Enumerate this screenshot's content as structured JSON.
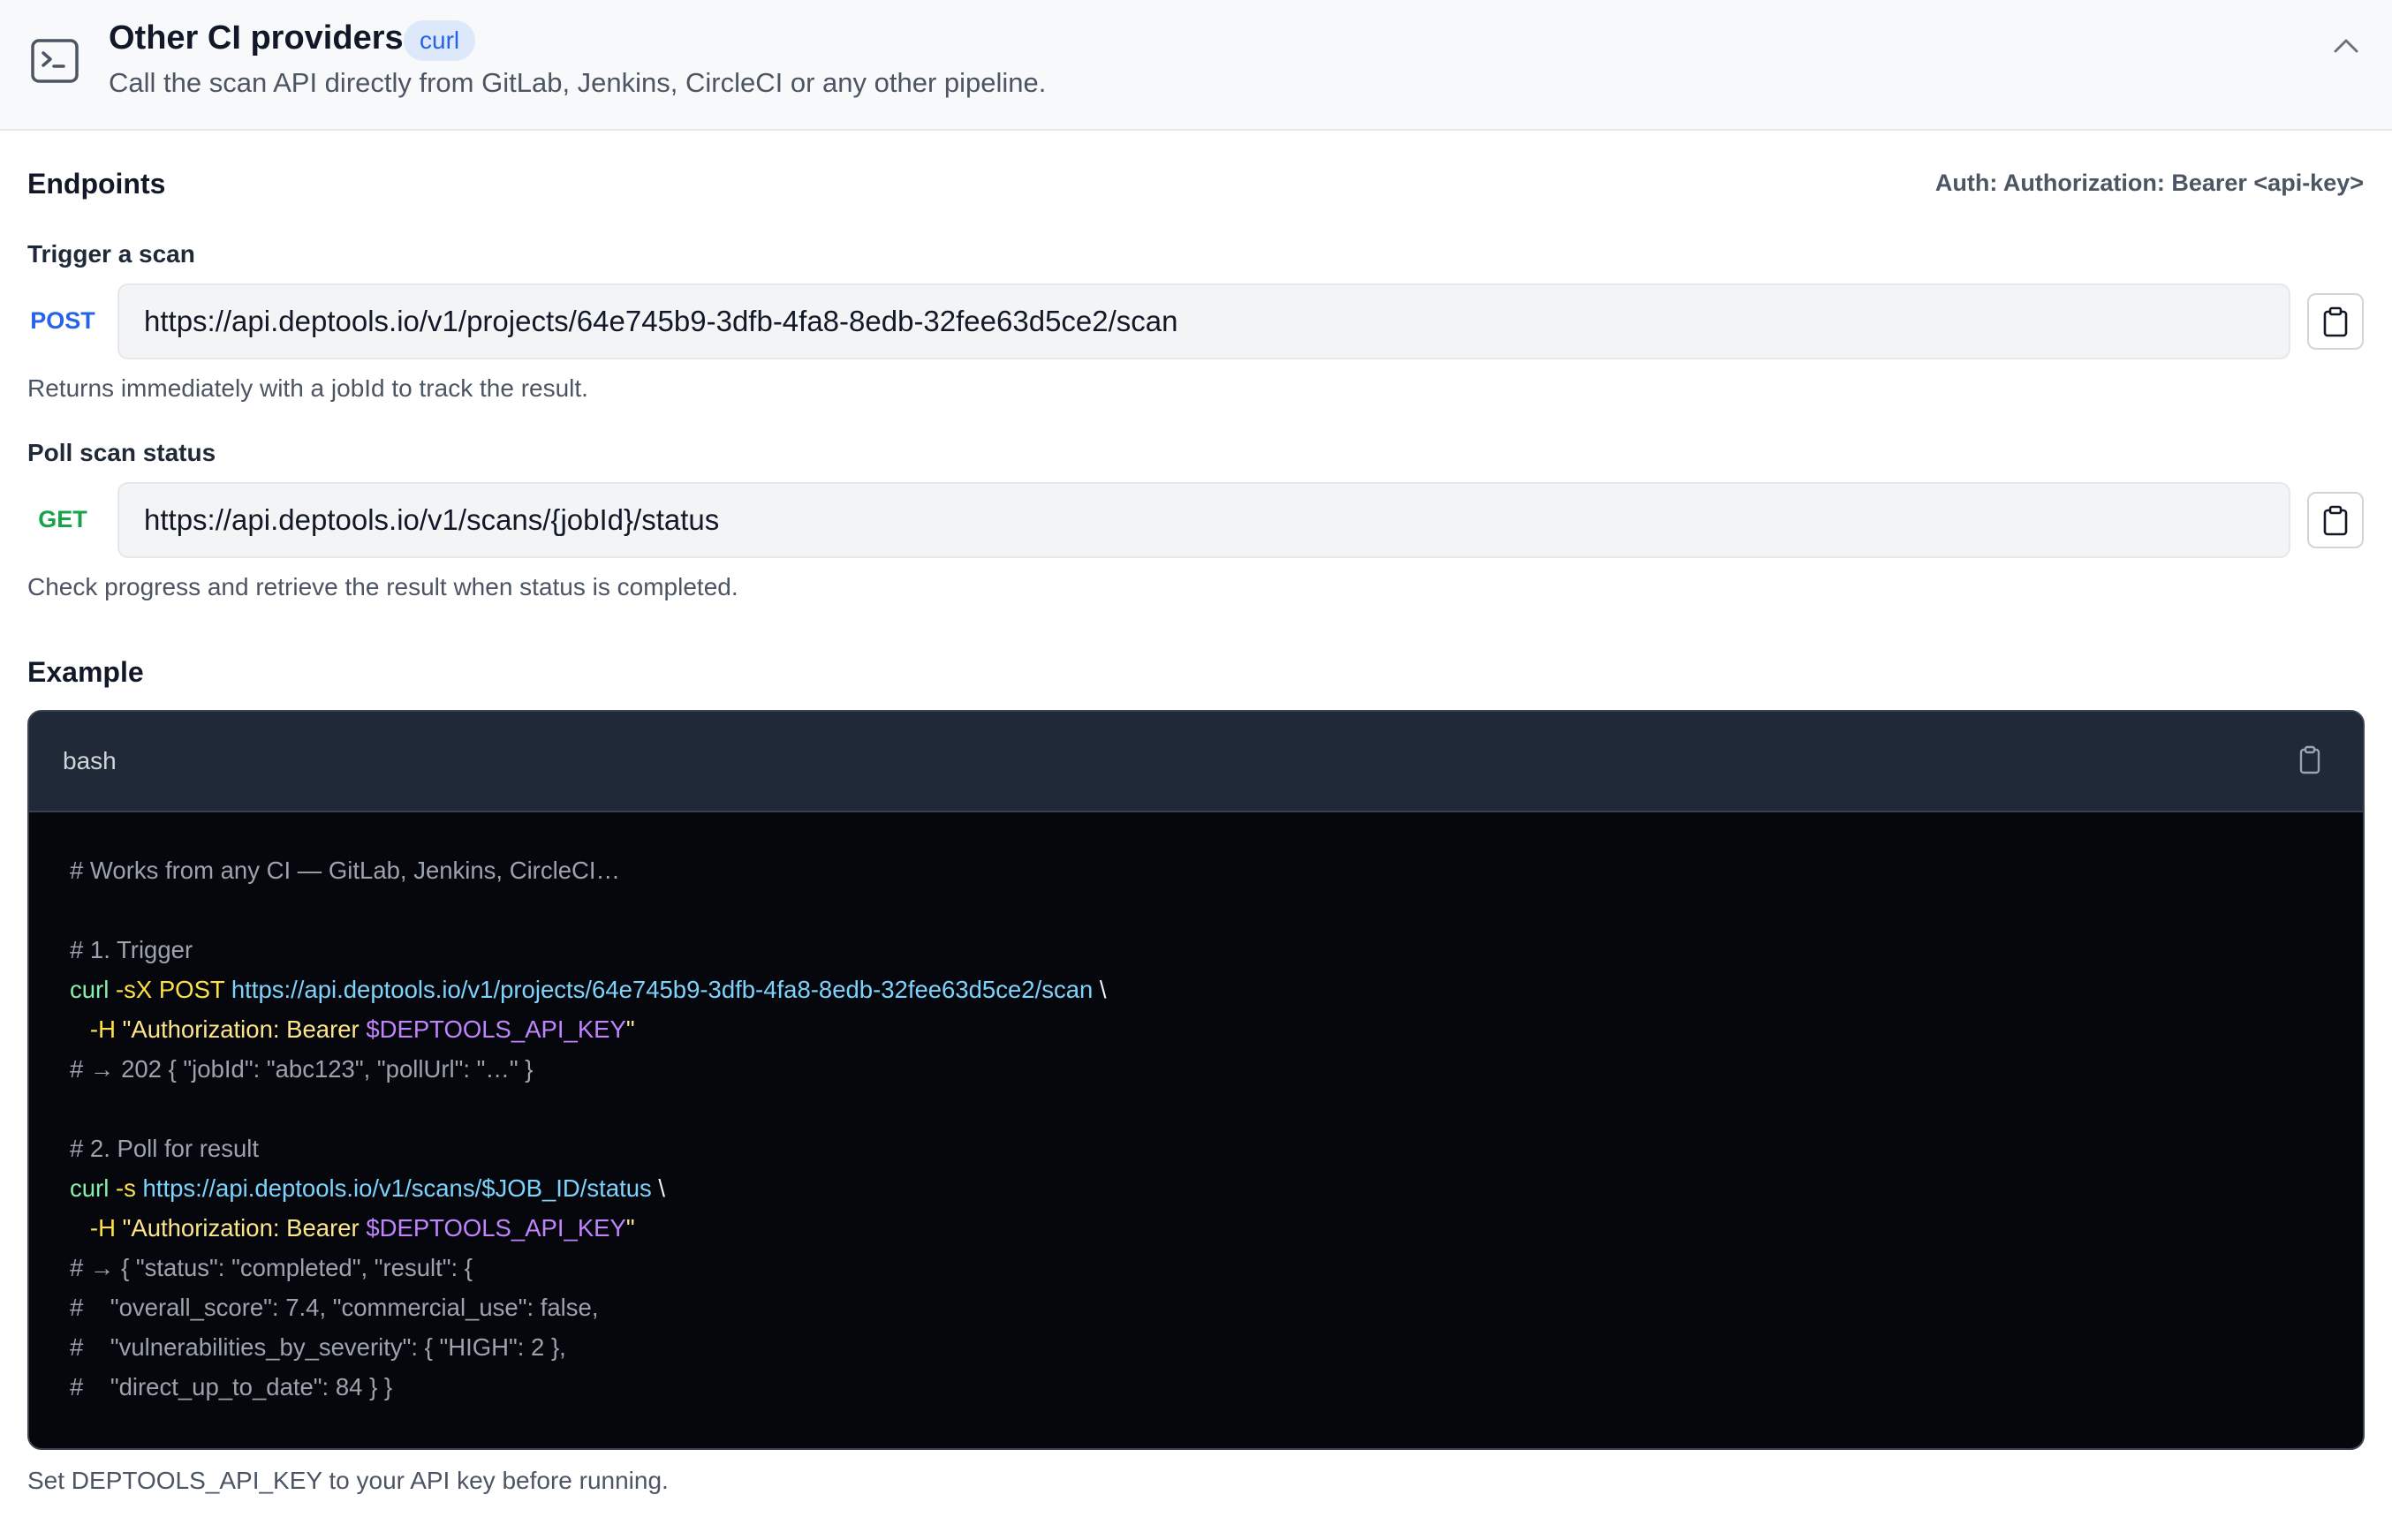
{
  "header": {
    "icon": "terminal-icon",
    "title": "Other CI providers",
    "badge": "curl",
    "subtitle": "Call the scan API directly from GitLab, Jenkins, CircleCI or any other pipeline.",
    "collapse_icon": "chevron-up-icon"
  },
  "endpoints": {
    "title": "Endpoints",
    "auth": "Auth: Authorization: Bearer <api-key>",
    "items": [
      {
        "label": "Trigger a scan",
        "method": "POST",
        "method_color": "#2563eb",
        "url": "https://api.deptools.io/v1/projects/64e745b9-3dfb-4fa8-8edb-32fee63d5ce2/scan",
        "description": "Returns immediately with a jobId to track the result.",
        "copy_icon": "clipboard-icon"
      },
      {
        "label": "Poll scan status",
        "method": "GET",
        "method_color": "#16a34a",
        "url": "https://api.deptools.io/v1/scans/{jobId}/status",
        "description": "Check progress and retrieve the result when status is completed.",
        "copy_icon": "clipboard-icon"
      }
    ]
  },
  "example": {
    "title": "Example",
    "language": "bash",
    "copy_icon": "clipboard-icon",
    "lines": [
      [
        {
          "t": "comment",
          "v": "# Works from any CI — GitLab, Jenkins, CircleCI…"
        }
      ],
      [],
      [
        {
          "t": "comment",
          "v": "# 1. Trigger"
        }
      ],
      [
        {
          "t": "cmd",
          "v": "curl"
        },
        {
          "t": "plain",
          "v": " "
        },
        {
          "t": "flag",
          "v": "-sX POST"
        },
        {
          "t": "plain",
          "v": " "
        },
        {
          "t": "url",
          "v": "https://api.deptools.io/v1/projects/64e745b9-3dfb-4fa8-8edb-32fee63d5ce2/scan"
        },
        {
          "t": "plain",
          "v": " \\"
        }
      ],
      [
        {
          "t": "plain",
          "v": "   "
        },
        {
          "t": "flag",
          "v": "-H"
        },
        {
          "t": "plain",
          "v": " "
        },
        {
          "t": "str",
          "v": "\"Authorization: Bearer "
        },
        {
          "t": "var",
          "v": "$DEPTOOLS_API_KEY"
        },
        {
          "t": "str",
          "v": "\""
        }
      ],
      [
        {
          "t": "comment",
          "v": "# → 202 { \"jobId\": \"abc123\", \"pollUrl\": \"…\" }"
        }
      ],
      [],
      [
        {
          "t": "comment",
          "v": "# 2. Poll for result"
        }
      ],
      [
        {
          "t": "cmd",
          "v": "curl"
        },
        {
          "t": "plain",
          "v": " "
        },
        {
          "t": "flag",
          "v": "-s"
        },
        {
          "t": "plain",
          "v": " "
        },
        {
          "t": "url",
          "v": "https://api.deptools.io/v1/scans/$JOB_ID/status"
        },
        {
          "t": "plain",
          "v": " \\"
        }
      ],
      [
        {
          "t": "plain",
          "v": "   "
        },
        {
          "t": "flag",
          "v": "-H"
        },
        {
          "t": "plain",
          "v": " "
        },
        {
          "t": "str",
          "v": "\"Authorization: Bearer "
        },
        {
          "t": "var",
          "v": "$DEPTOOLS_API_KEY"
        },
        {
          "t": "str",
          "v": "\""
        }
      ],
      [
        {
          "t": "comment",
          "v": "# → { \"status\": \"completed\", \"result\": {"
        }
      ],
      [
        {
          "t": "comment",
          "v": "#    \"overall_score\": 7.4, \"commercial_use\": false,"
        }
      ],
      [
        {
          "t": "comment",
          "v": "#    \"vulnerabilities_by_severity\": { \"HIGH\": 2 },"
        }
      ],
      [
        {
          "t": "comment",
          "v": "#    \"direct_up_to_date\": 84 } }"
        }
      ]
    ]
  },
  "footer_note": "Set DEPTOOLS_API_KEY to your API key before running."
}
